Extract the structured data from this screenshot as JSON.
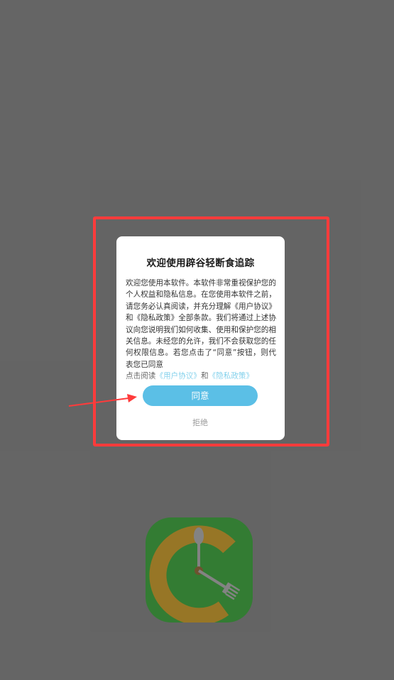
{
  "dialog": {
    "title": "欢迎使用辟谷轻断食追踪",
    "body_text": "欢迎您使用本软件。本软件非常重视保护您的个人权益和隐私信息。在您使用本软件之前，请您务必认真阅读，并充分理解《用户协议》和《隐私政策》全部条款。我们将通过上述协议向您说明我们如何收集、使用和保护您的相关信息。未经您的允许，我们不会获取您的任何权限信息。若您点击了“同意”按钮，则代表您已同意",
    "read_prefix": "点击阅读",
    "user_agreement_link": "《用户协议》",
    "and_text": "和",
    "privacy_policy_link": "《隐私政策》",
    "agree_label": "同意",
    "reject_label": "拒绝"
  },
  "colors": {
    "accent": "#5bbfe6",
    "link": "#5ec3e6",
    "annotation": "#ff3b3b",
    "icon_background": "#1f8f1f",
    "icon_ring": "#b8860b"
  },
  "icons": {
    "app_icon": "clock-fork-spoon-icon"
  }
}
